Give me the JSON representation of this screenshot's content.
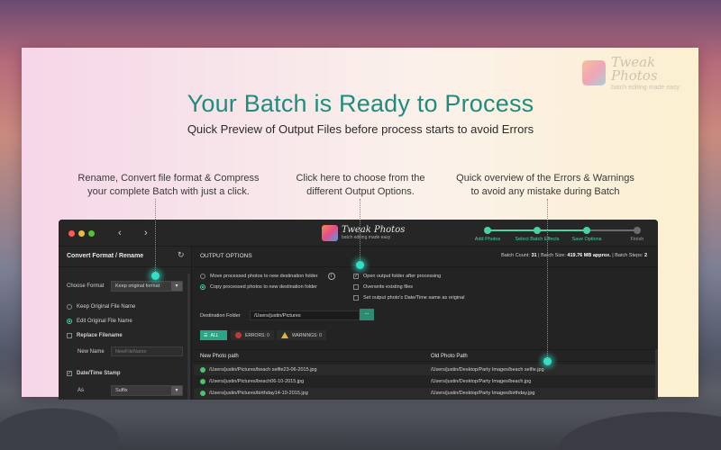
{
  "headline": "Your Batch is Ready to Process",
  "subhead": "Quick Preview of Output Files before process starts to avoid Errors",
  "brand": {
    "name": "Tweak Photos",
    "tagline": "batch editing made easy"
  },
  "callouts": [
    {
      "line1": "Rename, Convert file format & Compress",
      "line2": "your complete Batch with just a click."
    },
    {
      "line1": "Click here to choose from the",
      "line2": "different Output Options."
    },
    {
      "line1": "Quick overview of the Errors & Warnings",
      "line2": "to avoid any mistake during Batch"
    }
  ],
  "app": {
    "nav": {
      "back": "‹",
      "forward": "›"
    },
    "steps": [
      {
        "label": "Add Photos",
        "done": true
      },
      {
        "label": "Select Batch Effects",
        "done": true
      },
      {
        "label": "Save Options",
        "done": true
      },
      {
        "label": "Finish",
        "done": false
      }
    ],
    "left_panel": {
      "title": "Convert Format / Rename",
      "refresh_icon": "↻",
      "choose_format_label": "Choose Format",
      "choose_format_value": "Keep original format",
      "keep_name": "Keep Original File Name",
      "edit_name": "Edit Original File Name",
      "replace_filename": "Replace Filename",
      "new_name_label": "New Name",
      "new_name_placeholder": "NewFileName",
      "date_time_stamp": "Date/Time Stamp",
      "as_label": "As",
      "as_value": "Suffix"
    },
    "main": {
      "title": "OUTPUT OPTIONS",
      "stats": {
        "batch_count_label": "Batch Count:",
        "batch_count": "31",
        "batch_size_label": "Batch Size:",
        "batch_size": "419.76 MB approx.",
        "batch_steps_label": "Batch Steps:",
        "batch_steps": "2"
      },
      "options_left": [
        {
          "label": "Move processed photos to new destination folder",
          "selected": false
        },
        {
          "label": "Copy processed photos to new destination folder",
          "selected": true
        }
      ],
      "options_right": [
        {
          "label": "Open output folder after processing",
          "checked": true
        },
        {
          "label": "Overwrite existing files",
          "checked": false
        },
        {
          "label": "Set output photo's Date/Time same as original",
          "checked": false
        }
      ],
      "destination_label": "Destination Folder",
      "destination_value": "/Users/justin/Pictures",
      "browse": "...",
      "filters": {
        "all": "ALL",
        "errors": "ERRORS: 0",
        "warnings": "WARNINGS: 0"
      },
      "columns": [
        "New Photo path",
        "Old Photo Path"
      ],
      "rows": [
        {
          "new": "/Users/justin/Pictures/beach selfie23-06-2015.jpg",
          "old": "/Users/justin/Desktop/Party Images/beach selfie.jpg"
        },
        {
          "new": "/Users/justin/Pictures/beach06-10-2015.jpg",
          "old": "/Users/justin/Desktop/Party Images/beach.jpg"
        },
        {
          "new": "/Users/justin/Pictures/birthday14-10-2015.jpg",
          "old": "/Users/justin/Desktop/Party Images/birthday.jpg"
        }
      ]
    }
  }
}
